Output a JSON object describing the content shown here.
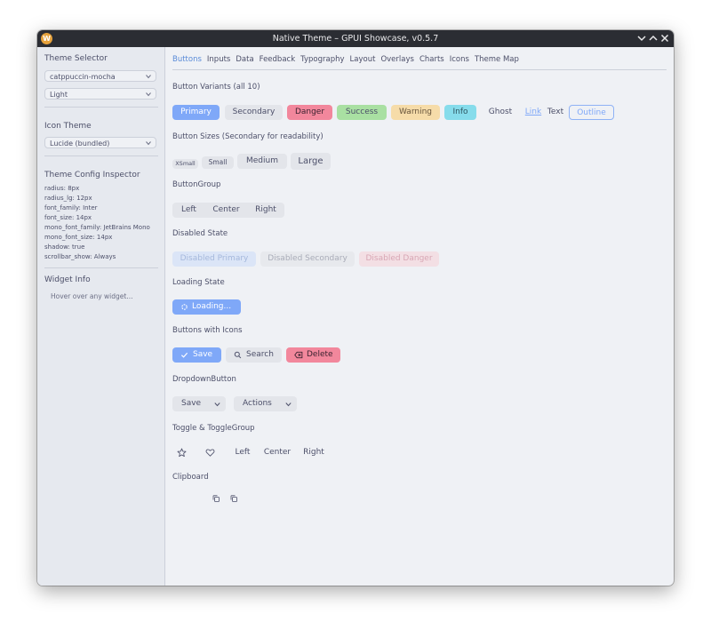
{
  "window": {
    "title": "Native Theme – GPUI Showcase, v0.5.7"
  },
  "sidebar": {
    "theme_selector_heading": "Theme Selector",
    "theme_value": "catppuccin-mocha",
    "mode_value": "Light",
    "icon_theme_heading": "Icon Theme",
    "icon_theme_value": "Lucide (bundled)",
    "config_heading": "Theme Config Inspector",
    "config_lines": [
      "radius: 8px",
      "radius_lg: 12px",
      "font_family: Inter",
      "font_size: 14px",
      "mono_font_family: JetBrains Mono",
      "mono_font_size: 14px",
      "shadow: true",
      "scrollbar_show: Always"
    ],
    "widget_info_heading": "Widget Info",
    "widget_info_hint": "Hover over any widget..."
  },
  "tabs": [
    "Buttons",
    "Inputs",
    "Data",
    "Feedback",
    "Typography",
    "Layout",
    "Overlays",
    "Charts",
    "Icons",
    "Theme Map"
  ],
  "sections": {
    "variants": "Button Variants (all 10)",
    "sizes": "Button Sizes (Secondary for readability)",
    "group": "ButtonGroup",
    "disabled": "Disabled State",
    "loading": "Loading State",
    "icons": "Buttons with Icons",
    "dropdown": "DropdownButton",
    "toggle": "Toggle & ToggleGroup",
    "clipboard": "Clipboard"
  },
  "variants": {
    "primary": "Primary",
    "secondary": "Secondary",
    "danger": "Danger",
    "success": "Success",
    "warning": "Warning",
    "info": "Info",
    "ghost": "Ghost",
    "link": "Link",
    "text": "Text",
    "outline": "Outline"
  },
  "sizes": {
    "xsmall": "XSmall",
    "small": "Small",
    "medium": "Medium",
    "large": "Large"
  },
  "button_group": {
    "left": "Left",
    "center": "Center",
    "right": "Right"
  },
  "disabled": {
    "primary": "Disabled Primary",
    "secondary": "Disabled Secondary",
    "danger": "Disabled Danger"
  },
  "loading": {
    "label": "Loading..."
  },
  "icon_buttons": {
    "save": "Save",
    "search": "Search",
    "delete": "Delete"
  },
  "dropdowns": {
    "save": "Save",
    "actions": "Actions"
  },
  "toggle_group": {
    "left": "Left",
    "center": "Center",
    "right": "Right"
  },
  "colors": {
    "primary": "#7fa8f8",
    "danger": "#f2879c",
    "success": "#a9e0a2",
    "warning": "#f6dca9",
    "info": "#86dceb",
    "titlebar": "#2b2d33",
    "sidebar": "#e6e9ef",
    "background": "#eff1f5"
  }
}
